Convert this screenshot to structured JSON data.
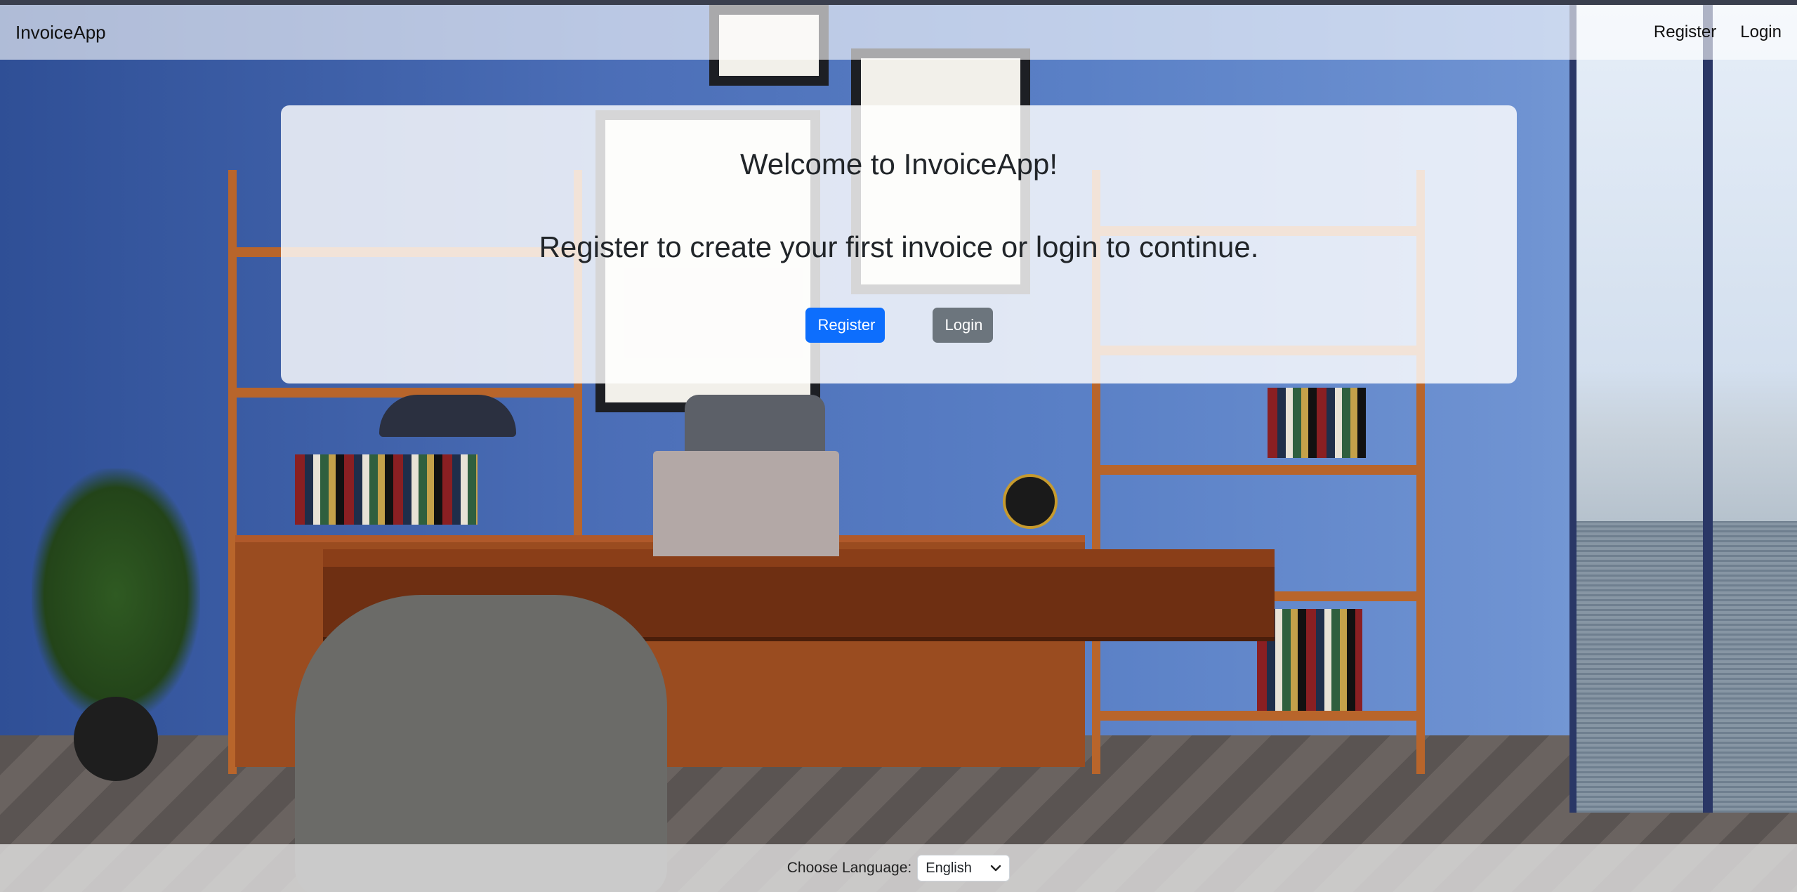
{
  "navbar": {
    "brand": "InvoiceApp",
    "links": [
      {
        "label": "Register"
      },
      {
        "label": "Login"
      }
    ]
  },
  "hero": {
    "title": "Welcome to InvoiceApp!",
    "subtitle": "Register to create your first invoice or login to continue.",
    "register_button": "Register",
    "login_button": "Login"
  },
  "footer": {
    "language_label": "Choose Language:",
    "language_selected": "English"
  },
  "colors": {
    "primary": "#0d6efd",
    "secondary": "#6c757d"
  },
  "icons": {
    "language_dropdown": "chevron-down-icon"
  }
}
